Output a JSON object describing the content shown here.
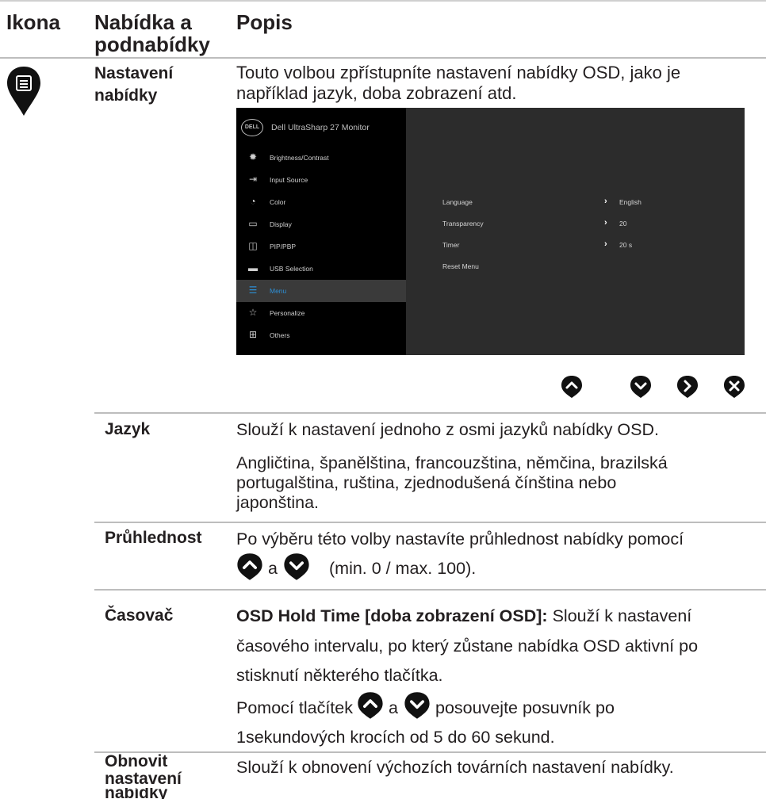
{
  "header": {
    "col_icon": "Ikona",
    "col_menu_line1": "Nabídka a",
    "col_menu_line2": "podnabídky",
    "col_desc": "Popis"
  },
  "menu_section": {
    "title_line1": "Nastavení",
    "title_line2": "nabídky",
    "desc_line1": "Touto volbou zpřístupníte nastavení nabídky OSD, jako je",
    "desc_line2": "například jazyk, doba zobrazení atd.",
    "icon": "menu-list-icon"
  },
  "osd": {
    "logo": "DELL",
    "title": "Dell UltraSharp 27 Monitor",
    "items": [
      {
        "label": "Brightness/Contrast",
        "icon": "brightness-icon"
      },
      {
        "label": "Input Source",
        "icon": "input-source-icon"
      },
      {
        "label": "Color",
        "icon": "color-icon"
      },
      {
        "label": "Display",
        "icon": "display-icon"
      },
      {
        "label": "PIP/PBP",
        "icon": "pip-icon"
      },
      {
        "label": "USB Selection",
        "icon": "usb-icon"
      },
      {
        "label": "Menu",
        "icon": "menu-icon"
      },
      {
        "label": "Personalize",
        "icon": "star-icon"
      },
      {
        "label": "Others",
        "icon": "others-icon"
      }
    ],
    "selected": "Menu",
    "rows": [
      {
        "label": "Language",
        "value": "English"
      },
      {
        "label": "Transparency",
        "value": "20"
      },
      {
        "label": "Timer",
        "value": "20 s"
      },
      {
        "label": "Reset Menu",
        "value": ""
      }
    ]
  },
  "nav_buttons": [
    "up-button",
    "down-button",
    "right-button",
    "exit-button"
  ],
  "rows": {
    "jazyk": {
      "term": "Jazyk",
      "p1": "Slouží k nastavení jednoho z osmi jazyků nabídky OSD.",
      "p2_l1": "Angličtina, španělština, francouzština, němčina, brazilská",
      "p2_l2": "portugalština, ruština, zjednodušená čínština nebo",
      "p2_l3": "japonština."
    },
    "pruhlednost": {
      "term": "Průhlednost",
      "l1": "Po výběru této volby nastavíte průhlednost nabídky pomocí",
      "a": "a",
      "range": "(min. 0 / max. 100)."
    },
    "casovac": {
      "term": "Časovač",
      "bold": "OSD Hold Time [doba zobrazení OSD]:",
      "l1_rest": " Slouží k nastavení",
      "l2": "časového intervalu, po který zůstane nabídka OSD aktivní po",
      "l3": "stisknutí některého tlačítka.",
      "l4_pre": "Pomocí tlačítek",
      "l4_a": "a",
      "l4_post": "posouvejte posuvník po",
      "l5": "1sekundových krocích od 5 do 60 sekund."
    },
    "obnovit": {
      "term_l1": "Obnovit",
      "term_l2": "nastavení",
      "term_l3": "nabídky",
      "desc": "Slouží k obnovení výchozích továrních nastavení nabídky."
    }
  },
  "colors": {
    "accent": "#2d8fd5",
    "text": "#231f20",
    "rule": "#bdbdbd"
  }
}
